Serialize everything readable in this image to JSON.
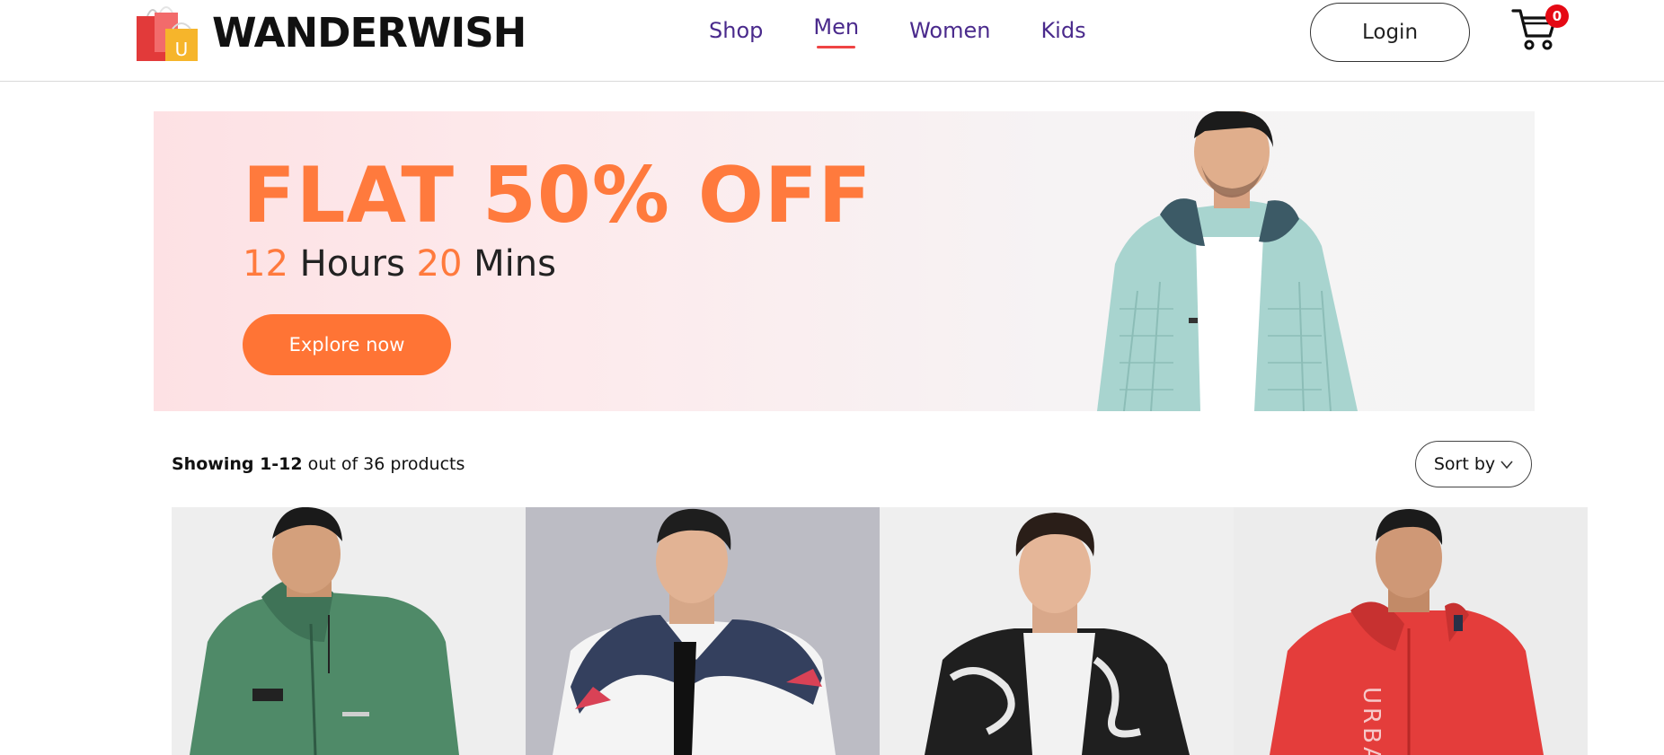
{
  "brand": {
    "name": "WANDERWISH",
    "logo_letter": "U"
  },
  "nav": {
    "items": [
      {
        "label": "Shop",
        "active": false
      },
      {
        "label": "Men",
        "active": true
      },
      {
        "label": "Women",
        "active": false
      },
      {
        "label": "Kids",
        "active": false
      }
    ]
  },
  "header": {
    "login_label": "Login",
    "cart_count": "0",
    "cart_icon": "cart-icon"
  },
  "banner": {
    "title": "FLAT 50% OFF",
    "hours_value": "12",
    "hours_label": " Hours ",
    "mins_value": "20",
    "mins_label": " Mins",
    "cta_label": "Explore now"
  },
  "listing": {
    "showing_bold": "Showing 1-12",
    "showing_rest": " out of 36 products",
    "sort_label": "Sort by",
    "sort_icon": "chevron-down-icon"
  },
  "products": [
    {
      "jacket_color": "#4f8a68",
      "bg": "#eeeeee"
    },
    {
      "jacket_color": "#34405e",
      "bg": "#bcbcc4"
    },
    {
      "jacket_color": "#1f1f1f",
      "bg": "#efefef"
    },
    {
      "jacket_color": "#e43d3b",
      "bg": "#ececec",
      "print_text": "URBA"
    }
  ],
  "colors": {
    "accent": "#ff7a3d",
    "nav": "#4a2a8c",
    "underline": "#ef4444",
    "badge": "#e50914"
  }
}
